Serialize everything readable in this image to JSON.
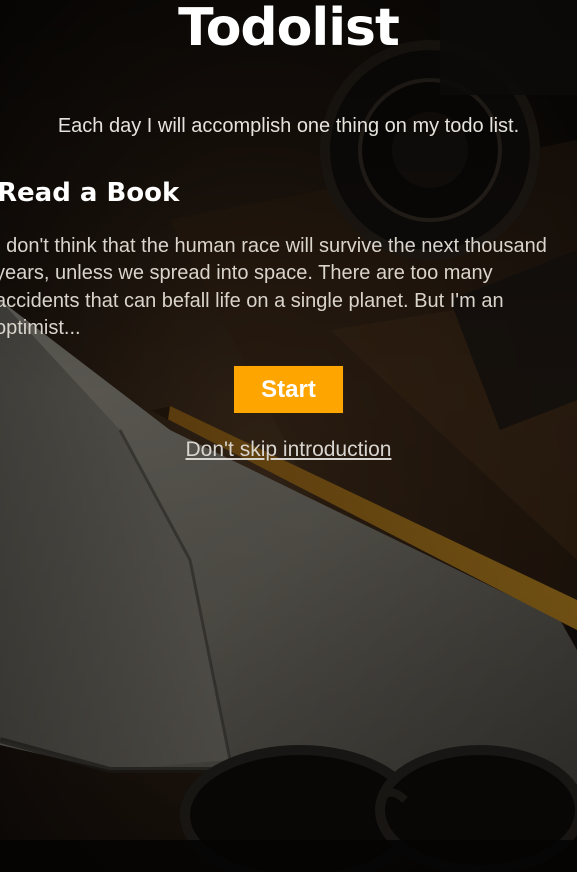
{
  "app": {
    "title": "Todolist",
    "tagline": "Each day I will accomplish one thing on my todo list."
  },
  "task": {
    "title": "Read a Book",
    "description": "I don't think that the human race will survive the next thousand years, unless we spread into space. There are too many accidents that can befall life on a single planet. But I'm an optimist..."
  },
  "actions": {
    "start_label": "Start",
    "skip_label": "Don't skip introduction"
  },
  "colors": {
    "accent": "#ffa500",
    "background": "#0b0908",
    "text": "#ffffff"
  },
  "background": {
    "icon": "notebook-pencil-photo"
  }
}
